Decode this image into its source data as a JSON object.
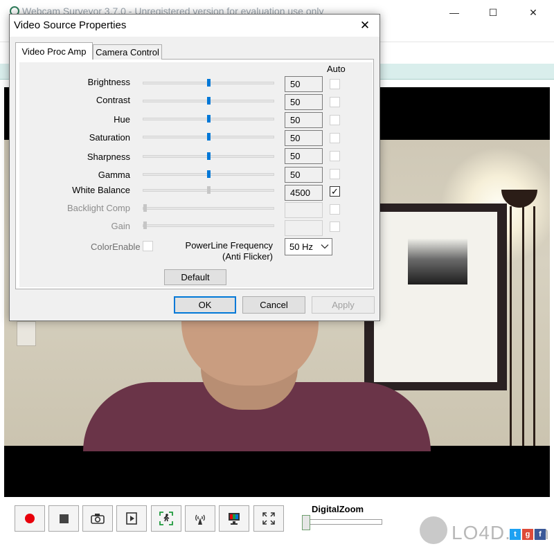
{
  "app": {
    "title": "Webcam Surveyor 3.7.0 - Unregistered version for evaluation use only",
    "window_controls": {
      "minimize": "—",
      "maximize": "☐",
      "close": "✕"
    }
  },
  "dialog": {
    "title": "Video Source Properties",
    "close": "✕",
    "tabs": [
      {
        "label": "Video Proc Amp",
        "active": true
      },
      {
        "label": "Camera Control",
        "active": false
      }
    ],
    "auto_header": "Auto",
    "rows": [
      {
        "label": "Brightness",
        "value": "50",
        "slider_fraction": 0.5,
        "enabled": true,
        "auto": false
      },
      {
        "label": "Contrast",
        "value": "50",
        "slider_fraction": 0.5,
        "enabled": true,
        "auto": false
      },
      {
        "label": "Hue",
        "value": "50",
        "slider_fraction": 0.5,
        "enabled": true,
        "auto": false
      },
      {
        "label": "Saturation",
        "value": "50",
        "slider_fraction": 0.5,
        "enabled": true,
        "auto": false
      },
      {
        "label": "Sharpness",
        "value": "50",
        "slider_fraction": 0.5,
        "enabled": true,
        "auto": false
      },
      {
        "label": "Gamma",
        "value": "50",
        "slider_fraction": 0.5,
        "enabled": true,
        "auto": false
      },
      {
        "label": "White Balance",
        "value": "4500",
        "slider_fraction": 0.5,
        "enabled": true,
        "auto": true
      },
      {
        "label": "Backlight Comp",
        "value": "",
        "slider_fraction": 0.0,
        "enabled": false,
        "auto": false
      },
      {
        "label": "Gain",
        "value": "",
        "slider_fraction": 0.0,
        "enabled": false,
        "auto": false
      }
    ],
    "color_enable_label": "ColorEnable",
    "powerline_label_line1": "PowerLine Frequency",
    "powerline_label_line2": "(Anti Flicker)",
    "powerline_value": "50 Hz",
    "default_button": "Default",
    "ok_button": "OK",
    "cancel_button": "Cancel",
    "apply_button": "Apply"
  },
  "toolbar": {
    "buttons": [
      "record",
      "stop",
      "snapshot",
      "playback",
      "motion-detect",
      "broadcast",
      "monitor",
      "fullscreen"
    ],
    "digital_zoom_label": "DigitalZoom",
    "digital_zoom_fraction": 0.0
  },
  "watermark": {
    "text": "LO4D.com"
  },
  "colors": {
    "accent": "#0078d7",
    "record": "#e8000b",
    "shirt": "#6a3448"
  }
}
